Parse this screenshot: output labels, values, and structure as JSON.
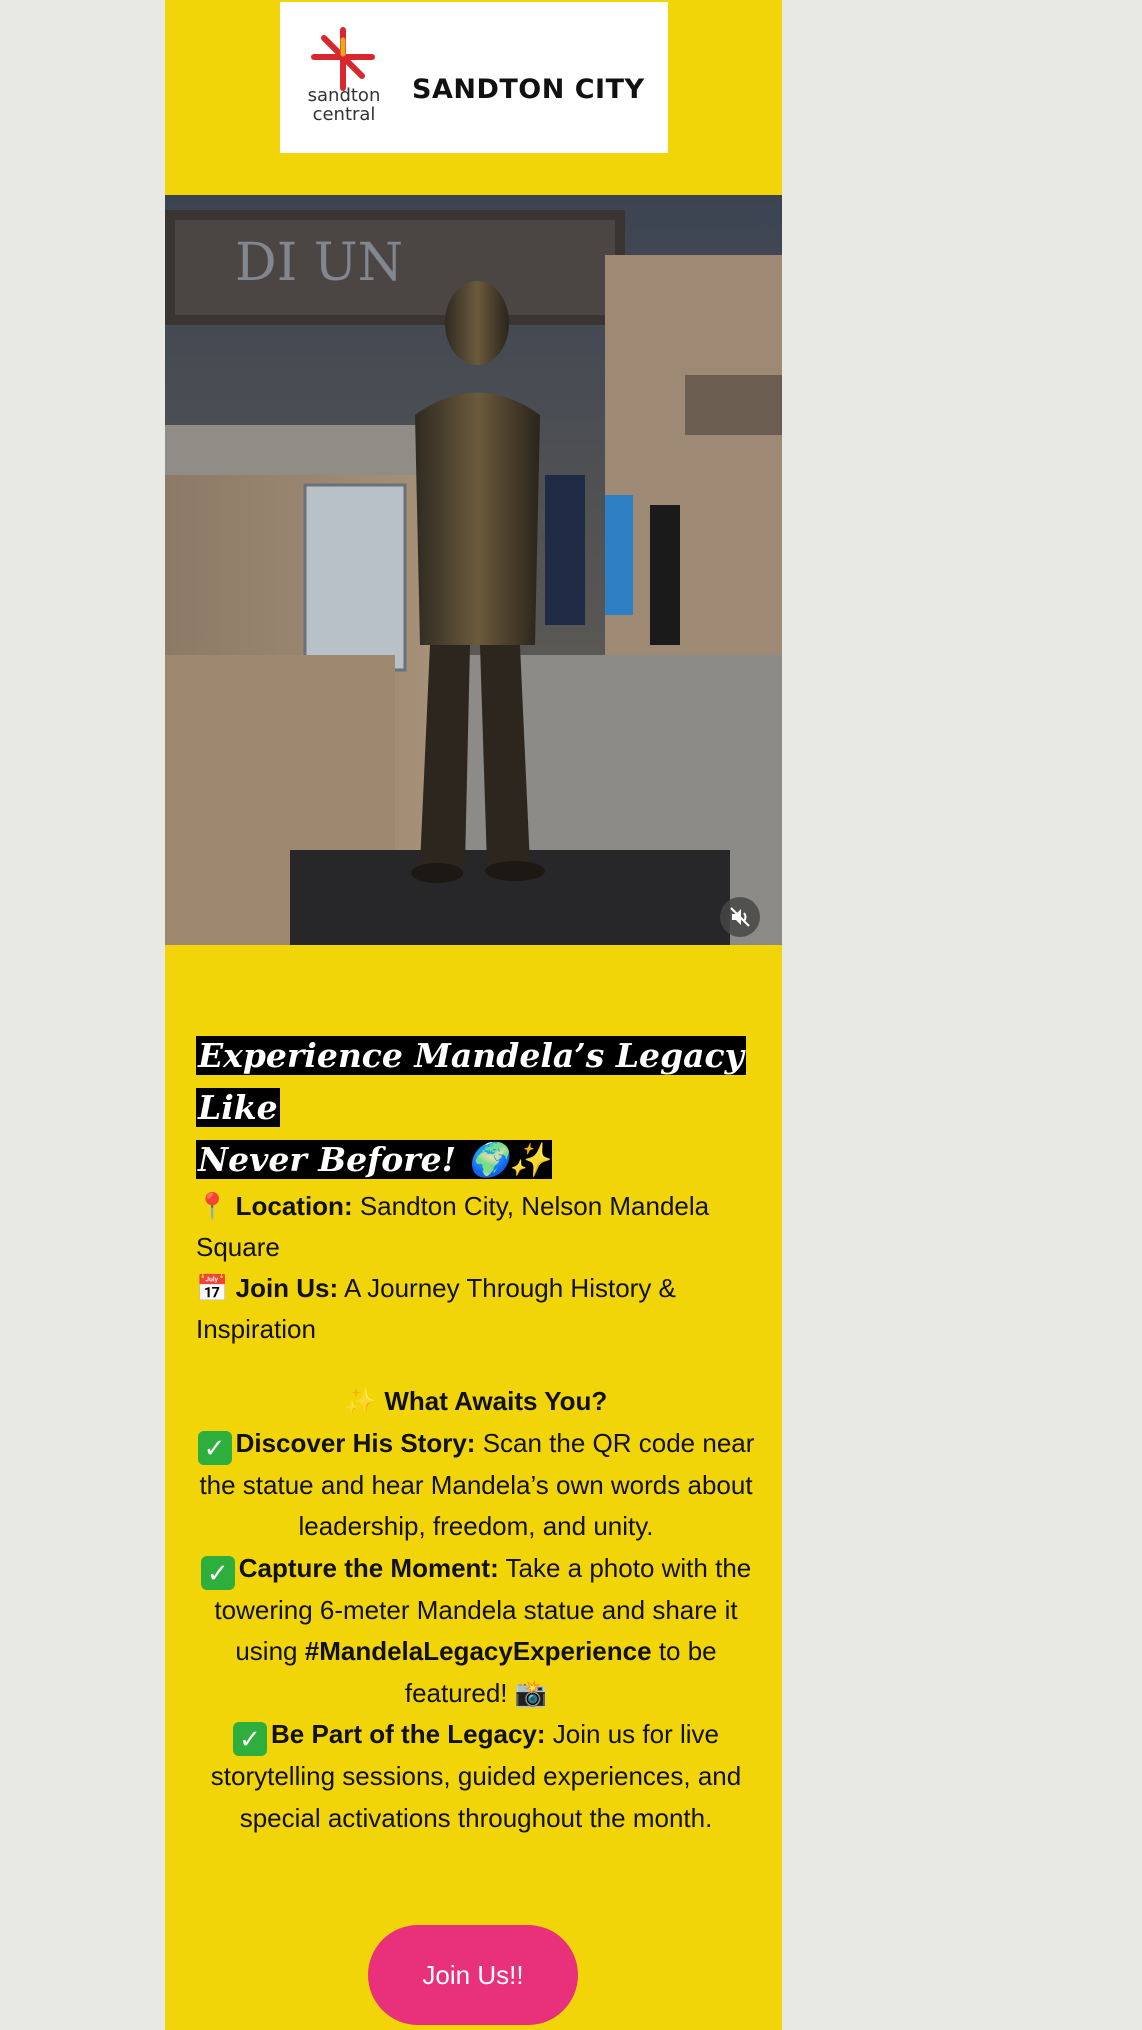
{
  "header": {
    "brand_small": "sandton central",
    "brand_big": "SANDTON CITY"
  },
  "hero": {
    "media_type": "video",
    "mute_icon": "muted-speaker-icon"
  },
  "intro": {
    "headline_line1": "Experience Mandela’s Legacy Like",
    "headline_line2": "Never Before! 🌍✨",
    "location_icon": "📍",
    "location_label": "Location:",
    "location_value": "Sandton City, Nelson Mandela Square",
    "joinus_icon": "📅",
    "joinus_label": "Join Us:",
    "joinus_value": "A Journey Through History & Inspiration"
  },
  "awaits": {
    "icon": "✨",
    "title": "What Awaits You?",
    "items": [
      {
        "label": "Discover His Story:",
        "text": "Scan the QR code near the statue and hear Mandela’s own words about leadership, freedom, and unity."
      },
      {
        "label": "Capture the Moment:",
        "text_before": "Take a photo with the towering 6-meter Mandela statue and share it using",
        "hashtag": "#MandelaLegacyExperience",
        "text_after": "to be featured! 📸"
      },
      {
        "label": "Be Part of the Legacy:",
        "text": "Join us for live storytelling sessions, guided experiences, and special activations throughout the month."
      }
    ]
  },
  "cta": {
    "label": "Join Us!!"
  },
  "colors": {
    "page_bg": "#e9e9e4",
    "column_bg": "#f1d509",
    "cta_bg": "#e8307b",
    "check_green": "#2eae3c"
  }
}
